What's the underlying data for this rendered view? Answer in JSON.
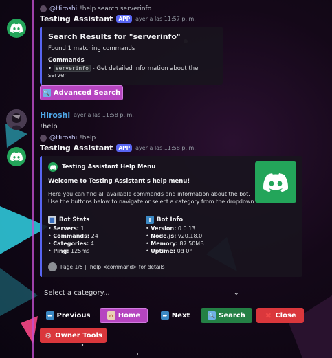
{
  "colors": {
    "accent": "#5865f2",
    "bot_green": "#23a55a",
    "purple_button": "#b645c0",
    "green_button": "#248045",
    "red_button": "#da373c"
  },
  "msg1": {
    "reply_user": "@Hiroshi",
    "reply_text": "!help search serverinfo",
    "author": "Testing Assistant",
    "app_tag": "APP",
    "timestamp": "ayer a las 11:57 p. m.",
    "embed_title": "Search Results for \"serverinfo\"",
    "embed_found": "Found 1 matching commands",
    "embed_section": "Commands",
    "command_bullet": "•",
    "command_name": "serverinfo",
    "command_desc": "- Get detailed information about the server",
    "advanced_search_label": "Advanced Search",
    "advanced_search_icon": "magnifier-icon"
  },
  "msg2": {
    "author": "Hiroshi",
    "timestamp": "ayer a las 11:58 p. m.",
    "text": "!help"
  },
  "msg3": {
    "reply_user": "@Hiroshi",
    "reply_text": "!help",
    "author": "Testing Assistant",
    "app_tag": "APP",
    "timestamp": "ayer a las 11:58 p. m.",
    "embed_title": "Testing Assistant Help Menu",
    "welcome": "Welcome to Testing Assistant's help menu!",
    "desc1": "Here you can find all available commands and information about the bot.",
    "desc2": "Use the buttons below to navigate or select a category from the dropdown.",
    "stats_title": "Bot Stats",
    "stats": [
      {
        "label": "Servers:",
        "value": "1"
      },
      {
        "label": "Commands:",
        "value": "24"
      },
      {
        "label": "Categories:",
        "value": "4"
      },
      {
        "label": "Ping:",
        "value": "125ms"
      }
    ],
    "info_title": "Bot Info",
    "info": [
      {
        "label": "Version:",
        "value": "0.0.13"
      },
      {
        "label": "Node.js:",
        "value": "v20.18.0"
      },
      {
        "label": "Memory:",
        "value": "87.50MB"
      },
      {
        "label": "Uptime:",
        "value": "0d 0h"
      }
    ],
    "footer": "Page 1/5 | !help <command> for details",
    "select_placeholder": "Select a category...",
    "buttons": {
      "previous": "Previous",
      "home": "Home",
      "next": "Next",
      "search": "Search",
      "close": "Close",
      "owner_tools": "Owner Tools"
    }
  }
}
